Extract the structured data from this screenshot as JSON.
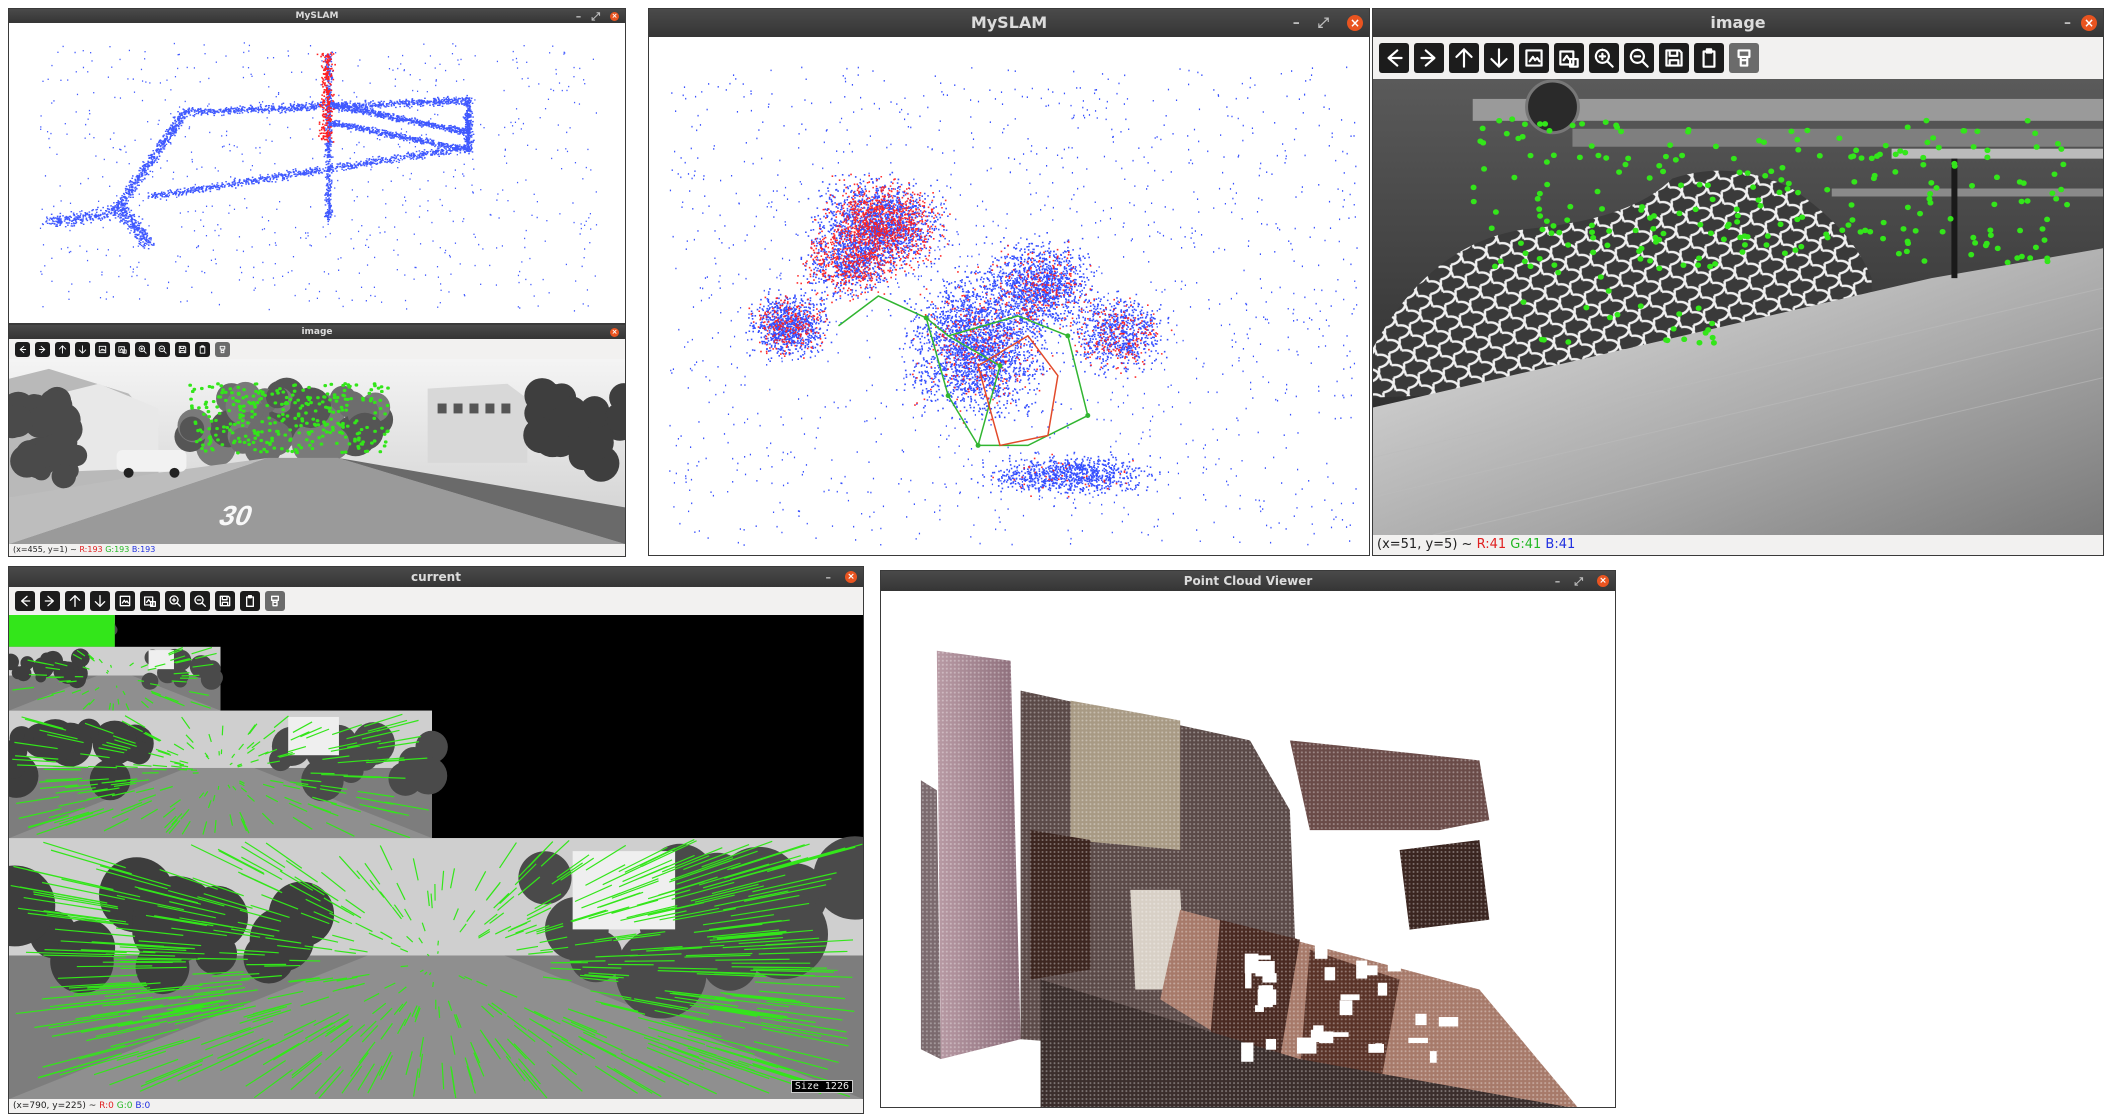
{
  "windows": {
    "myslam_small": {
      "title": "MySLAM"
    },
    "image_small": {
      "title": "image",
      "status": {
        "coords": "(x=455, y=1) ~ ",
        "r": "R:193",
        "g": "G:193",
        "b": "B:193"
      }
    },
    "myslam_large": {
      "title": "MySLAM"
    },
    "image_large": {
      "title": "image",
      "status": {
        "coords": "(x=51, y=5) ~ ",
        "r": "R:41",
        "g": "G:41",
        "b": "B:41"
      }
    },
    "current": {
      "title": "current",
      "status": {
        "coords": "(x=790, y=225) ~ ",
        "r": "R:0",
        "g": "G:0",
        "b": "B:0"
      },
      "corner_label": "Size 1226"
    },
    "point_cloud": {
      "title": "Point Cloud Viewer"
    }
  },
  "road_marking": "30",
  "toolbar_icons": [
    "arrow-left-icon",
    "arrow-right-icon",
    "arrow-up-icon",
    "arrow-down-icon",
    "image-icon",
    "image-properties-icon",
    "zoom-in-icon",
    "zoom-out-icon",
    "save-icon",
    "clipboard-icon",
    "settings-icon"
  ],
  "colors": {
    "titlebar": "#3c3c3c",
    "close": "#e95420",
    "map_points": "#1f3cff",
    "active_points": "#ff2020",
    "features": "#33e61a",
    "trajectory": "#31b531"
  }
}
